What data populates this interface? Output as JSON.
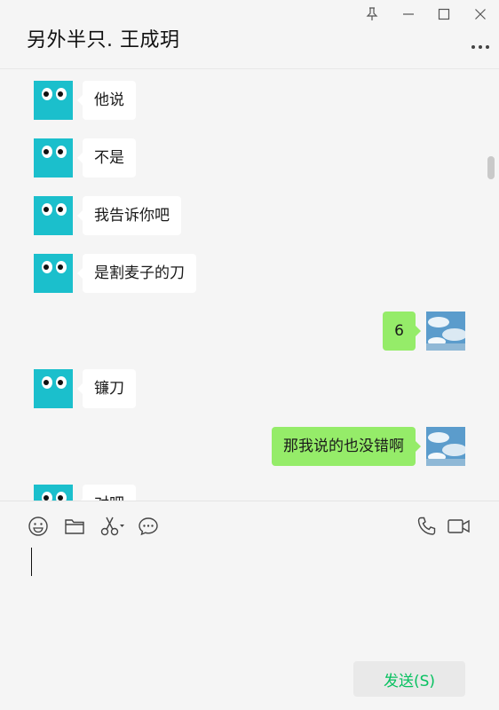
{
  "window": {
    "title": "另外半只. 王成玥",
    "controls": [
      "pin-icon",
      "minimize-icon",
      "maximize-icon",
      "close-icon"
    ],
    "more_icon": "more-dots-icon"
  },
  "colors": {
    "background": "#f5f5f5",
    "incoming_bubble": "#ffffff",
    "outgoing_bubble": "#95ec69",
    "avatar_teal": "#1bbfcc",
    "send_text": "#07c160",
    "send_button_bg": "#e9e9e9"
  },
  "messages": [
    {
      "side": "left",
      "text": "他说"
    },
    {
      "side": "left",
      "text": "不是"
    },
    {
      "side": "left",
      "text": "我告诉你吧"
    },
    {
      "side": "left",
      "text": "是割麦子的刀"
    },
    {
      "side": "right",
      "text": "6"
    },
    {
      "side": "left",
      "text": "镰刀"
    },
    {
      "side": "right",
      "text": "那我说的也没错啊"
    },
    {
      "side": "left",
      "text": "对吧"
    }
  ],
  "toolbar": {
    "icons": [
      "emoji-icon",
      "folder-icon",
      "scissors-icon",
      "chat-history-icon"
    ],
    "right_icons": [
      "phone-call-icon",
      "video-call-icon"
    ]
  },
  "composer": {
    "value": "",
    "send_label": "发送(S)"
  }
}
